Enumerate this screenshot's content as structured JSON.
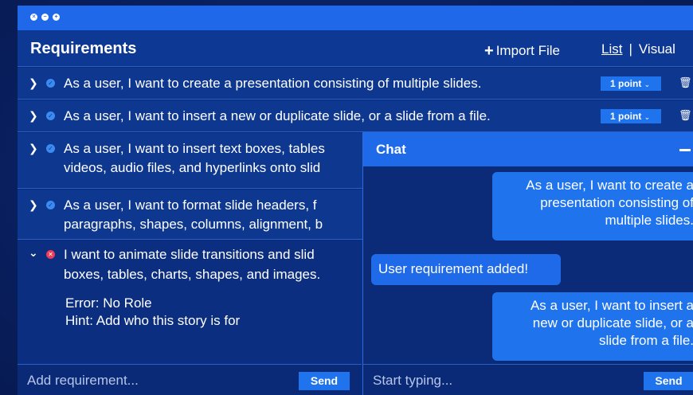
{
  "header": {
    "title": "Requirements",
    "import_label": "Import File",
    "view_list": "List",
    "view_sep": "|",
    "view_visual": "Visual"
  },
  "requirements": [
    {
      "text": "As a user, I want to create a presentation consisting of multiple slides.",
      "points": "1 point",
      "status": "ok"
    },
    {
      "text": "As a user, I want to insert a new or duplicate slide, or a slide from a file.",
      "points": "1 point",
      "status": "ok"
    },
    {
      "line1": "As a user, I want to insert text boxes, tables",
      "line2": "videos, audio files, and hyperlinks onto slid",
      "status": "ok"
    },
    {
      "line1": "As a user, I want  to format slide headers, f",
      "line2": "paragraphs, shapes, columns, alignment, b",
      "status": "ok"
    },
    {
      "line1": "I want to animate slide transitions and slid",
      "line2": "boxes, tables, charts, shapes, and images.",
      "status": "error",
      "error": "Error: No Role",
      "hint": "Hint: Add who this story is for"
    }
  ],
  "footer": {
    "placeholder": "Add requirement...",
    "send": "Send"
  },
  "chat": {
    "title": "Chat",
    "messages": [
      {
        "from": "user",
        "lines": [
          "As a user, I want to create a",
          "presentation consisting of",
          "multiple slides."
        ]
      },
      {
        "from": "bot",
        "lines": [
          "User requirement added!"
        ]
      },
      {
        "from": "user",
        "lines": [
          "As a user, I want to insert a",
          "new or duplicate slide, or a",
          "slide from a file."
        ]
      }
    ],
    "placeholder": "Start typing...",
    "send": "Send"
  },
  "colors": {
    "accent": "#1f74ee",
    "titlebar": "#1f68ea",
    "error": "#ef3b55"
  }
}
